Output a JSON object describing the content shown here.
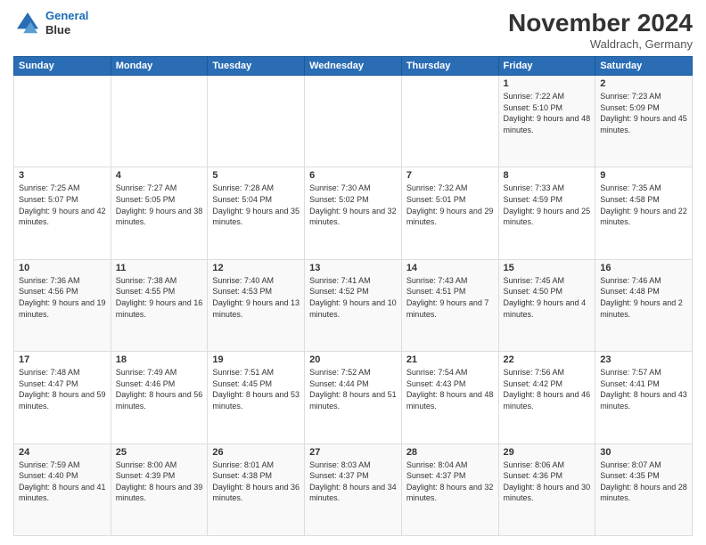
{
  "logo": {
    "line1": "General",
    "line2": "Blue"
  },
  "header": {
    "title": "November 2024",
    "subtitle": "Waldrach, Germany"
  },
  "weekdays": [
    "Sunday",
    "Monday",
    "Tuesday",
    "Wednesday",
    "Thursday",
    "Friday",
    "Saturday"
  ],
  "weeks": [
    [
      {
        "day": "",
        "sunrise": "",
        "sunset": "",
        "daylight": ""
      },
      {
        "day": "",
        "sunrise": "",
        "sunset": "",
        "daylight": ""
      },
      {
        "day": "",
        "sunrise": "",
        "sunset": "",
        "daylight": ""
      },
      {
        "day": "",
        "sunrise": "",
        "sunset": "",
        "daylight": ""
      },
      {
        "day": "",
        "sunrise": "",
        "sunset": "",
        "daylight": ""
      },
      {
        "day": "1",
        "sunrise": "Sunrise: 7:22 AM",
        "sunset": "Sunset: 5:10 PM",
        "daylight": "Daylight: 9 hours and 48 minutes."
      },
      {
        "day": "2",
        "sunrise": "Sunrise: 7:23 AM",
        "sunset": "Sunset: 5:09 PM",
        "daylight": "Daylight: 9 hours and 45 minutes."
      }
    ],
    [
      {
        "day": "3",
        "sunrise": "Sunrise: 7:25 AM",
        "sunset": "Sunset: 5:07 PM",
        "daylight": "Daylight: 9 hours and 42 minutes."
      },
      {
        "day": "4",
        "sunrise": "Sunrise: 7:27 AM",
        "sunset": "Sunset: 5:05 PM",
        "daylight": "Daylight: 9 hours and 38 minutes."
      },
      {
        "day": "5",
        "sunrise": "Sunrise: 7:28 AM",
        "sunset": "Sunset: 5:04 PM",
        "daylight": "Daylight: 9 hours and 35 minutes."
      },
      {
        "day": "6",
        "sunrise": "Sunrise: 7:30 AM",
        "sunset": "Sunset: 5:02 PM",
        "daylight": "Daylight: 9 hours and 32 minutes."
      },
      {
        "day": "7",
        "sunrise": "Sunrise: 7:32 AM",
        "sunset": "Sunset: 5:01 PM",
        "daylight": "Daylight: 9 hours and 29 minutes."
      },
      {
        "day": "8",
        "sunrise": "Sunrise: 7:33 AM",
        "sunset": "Sunset: 4:59 PM",
        "daylight": "Daylight: 9 hours and 25 minutes."
      },
      {
        "day": "9",
        "sunrise": "Sunrise: 7:35 AM",
        "sunset": "Sunset: 4:58 PM",
        "daylight": "Daylight: 9 hours and 22 minutes."
      }
    ],
    [
      {
        "day": "10",
        "sunrise": "Sunrise: 7:36 AM",
        "sunset": "Sunset: 4:56 PM",
        "daylight": "Daylight: 9 hours and 19 minutes."
      },
      {
        "day": "11",
        "sunrise": "Sunrise: 7:38 AM",
        "sunset": "Sunset: 4:55 PM",
        "daylight": "Daylight: 9 hours and 16 minutes."
      },
      {
        "day": "12",
        "sunrise": "Sunrise: 7:40 AM",
        "sunset": "Sunset: 4:53 PM",
        "daylight": "Daylight: 9 hours and 13 minutes."
      },
      {
        "day": "13",
        "sunrise": "Sunrise: 7:41 AM",
        "sunset": "Sunset: 4:52 PM",
        "daylight": "Daylight: 9 hours and 10 minutes."
      },
      {
        "day": "14",
        "sunrise": "Sunrise: 7:43 AM",
        "sunset": "Sunset: 4:51 PM",
        "daylight": "Daylight: 9 hours and 7 minutes."
      },
      {
        "day": "15",
        "sunrise": "Sunrise: 7:45 AM",
        "sunset": "Sunset: 4:50 PM",
        "daylight": "Daylight: 9 hours and 4 minutes."
      },
      {
        "day": "16",
        "sunrise": "Sunrise: 7:46 AM",
        "sunset": "Sunset: 4:48 PM",
        "daylight": "Daylight: 9 hours and 2 minutes."
      }
    ],
    [
      {
        "day": "17",
        "sunrise": "Sunrise: 7:48 AM",
        "sunset": "Sunset: 4:47 PM",
        "daylight": "Daylight: 8 hours and 59 minutes."
      },
      {
        "day": "18",
        "sunrise": "Sunrise: 7:49 AM",
        "sunset": "Sunset: 4:46 PM",
        "daylight": "Daylight: 8 hours and 56 minutes."
      },
      {
        "day": "19",
        "sunrise": "Sunrise: 7:51 AM",
        "sunset": "Sunset: 4:45 PM",
        "daylight": "Daylight: 8 hours and 53 minutes."
      },
      {
        "day": "20",
        "sunrise": "Sunrise: 7:52 AM",
        "sunset": "Sunset: 4:44 PM",
        "daylight": "Daylight: 8 hours and 51 minutes."
      },
      {
        "day": "21",
        "sunrise": "Sunrise: 7:54 AM",
        "sunset": "Sunset: 4:43 PM",
        "daylight": "Daylight: 8 hours and 48 minutes."
      },
      {
        "day": "22",
        "sunrise": "Sunrise: 7:56 AM",
        "sunset": "Sunset: 4:42 PM",
        "daylight": "Daylight: 8 hours and 46 minutes."
      },
      {
        "day": "23",
        "sunrise": "Sunrise: 7:57 AM",
        "sunset": "Sunset: 4:41 PM",
        "daylight": "Daylight: 8 hours and 43 minutes."
      }
    ],
    [
      {
        "day": "24",
        "sunrise": "Sunrise: 7:59 AM",
        "sunset": "Sunset: 4:40 PM",
        "daylight": "Daylight: 8 hours and 41 minutes."
      },
      {
        "day": "25",
        "sunrise": "Sunrise: 8:00 AM",
        "sunset": "Sunset: 4:39 PM",
        "daylight": "Daylight: 8 hours and 39 minutes."
      },
      {
        "day": "26",
        "sunrise": "Sunrise: 8:01 AM",
        "sunset": "Sunset: 4:38 PM",
        "daylight": "Daylight: 8 hours and 36 minutes."
      },
      {
        "day": "27",
        "sunrise": "Sunrise: 8:03 AM",
        "sunset": "Sunset: 4:37 PM",
        "daylight": "Daylight: 8 hours and 34 minutes."
      },
      {
        "day": "28",
        "sunrise": "Sunrise: 8:04 AM",
        "sunset": "Sunset: 4:37 PM",
        "daylight": "Daylight: 8 hours and 32 minutes."
      },
      {
        "day": "29",
        "sunrise": "Sunrise: 8:06 AM",
        "sunset": "Sunset: 4:36 PM",
        "daylight": "Daylight: 8 hours and 30 minutes."
      },
      {
        "day": "30",
        "sunrise": "Sunrise: 8:07 AM",
        "sunset": "Sunset: 4:35 PM",
        "daylight": "Daylight: 8 hours and 28 minutes."
      }
    ]
  ]
}
